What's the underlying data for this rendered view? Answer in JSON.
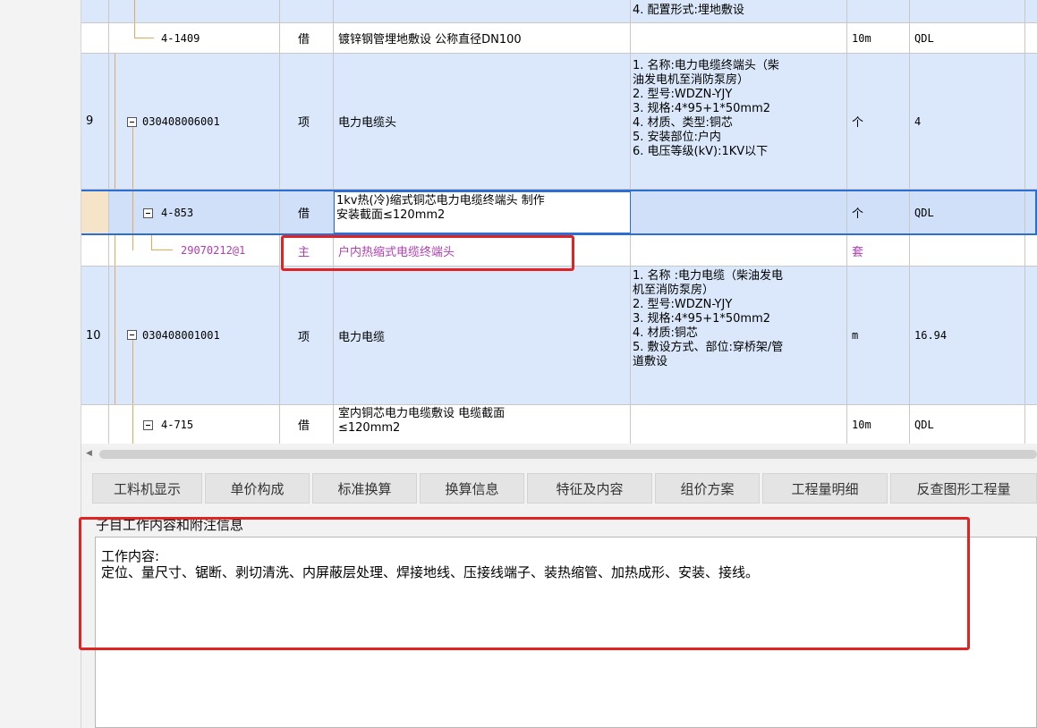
{
  "rows": [
    {
      "num": "",
      "code": "",
      "type": "",
      "name": "",
      "features": "4. 配置形式:埋地敷设",
      "unit": "",
      "qty": ""
    },
    {
      "num": "",
      "code": "4-1409",
      "type": "借",
      "name": "镀锌钢管埋地敷设 公称直径DN100",
      "features": "",
      "unit": "10m",
      "qty": "QDL"
    },
    {
      "num": "9",
      "code": "030408006001",
      "type": "项",
      "name": "电力电缆头",
      "features": "1. 名称:电力电缆终端头（柴\n油发电机至消防泵房）\n2. 型号:WDZN-YJY\n3. 规格:4*95+1*50mm2\n4. 材质、类型:铜芯\n5. 安装部位:户内\n6. 电压等级(kV):1KV以下",
      "unit": "个",
      "qty": "4"
    },
    {
      "num": "",
      "code": "4-853",
      "type": "借",
      "name": "1kv热(冷)缩式铜芯电力电缆终端头 制作\n安装截面≤120mm2",
      "features": "",
      "unit": "个",
      "qty": "QDL"
    },
    {
      "num": "",
      "code": "29070212@1",
      "type": "主",
      "name": "户内热缩式电缆终端头",
      "features": "",
      "unit": "套",
      "qty": ""
    },
    {
      "num": "10",
      "code": "030408001001",
      "type": "项",
      "name": "电力电缆",
      "features": "1. 名称 :电力电缆（柴油发电\n机至消防泵房）\n2. 型号:WDZN-YJY\n3. 规格:4*95+1*50mm2\n4. 材质:铜芯\n5. 敷设方式、部位:穿桥架/管\n道敷设",
      "unit": "m",
      "qty": "16.94"
    },
    {
      "num": "",
      "code": "4-715",
      "type": "借",
      "name": "室内铜芯电力电缆敷设 电缆截面\n≤120mm2",
      "features": "",
      "unit": "10m",
      "qty": "QDL"
    }
  ],
  "tabs": [
    "工料机显示",
    "单价构成",
    "标准换算",
    "换算信息",
    "特征及内容",
    "组价方案",
    "工程量明细",
    "反查图形工程量"
  ],
  "panel": {
    "title": "子目工作内容和附注信息",
    "label": "工作内容:",
    "content": "定位、量尺寸、锯断、剥切清洗、内屏蔽层处理、焊接地线、压接线端子、装热缩管、加热成形、安装、接线。"
  },
  "colors": {
    "highlight": "#e02424",
    "main_item": "#b040b0",
    "selected_border": "#2b6fd6",
    "tree_line": "#e3a95a"
  }
}
